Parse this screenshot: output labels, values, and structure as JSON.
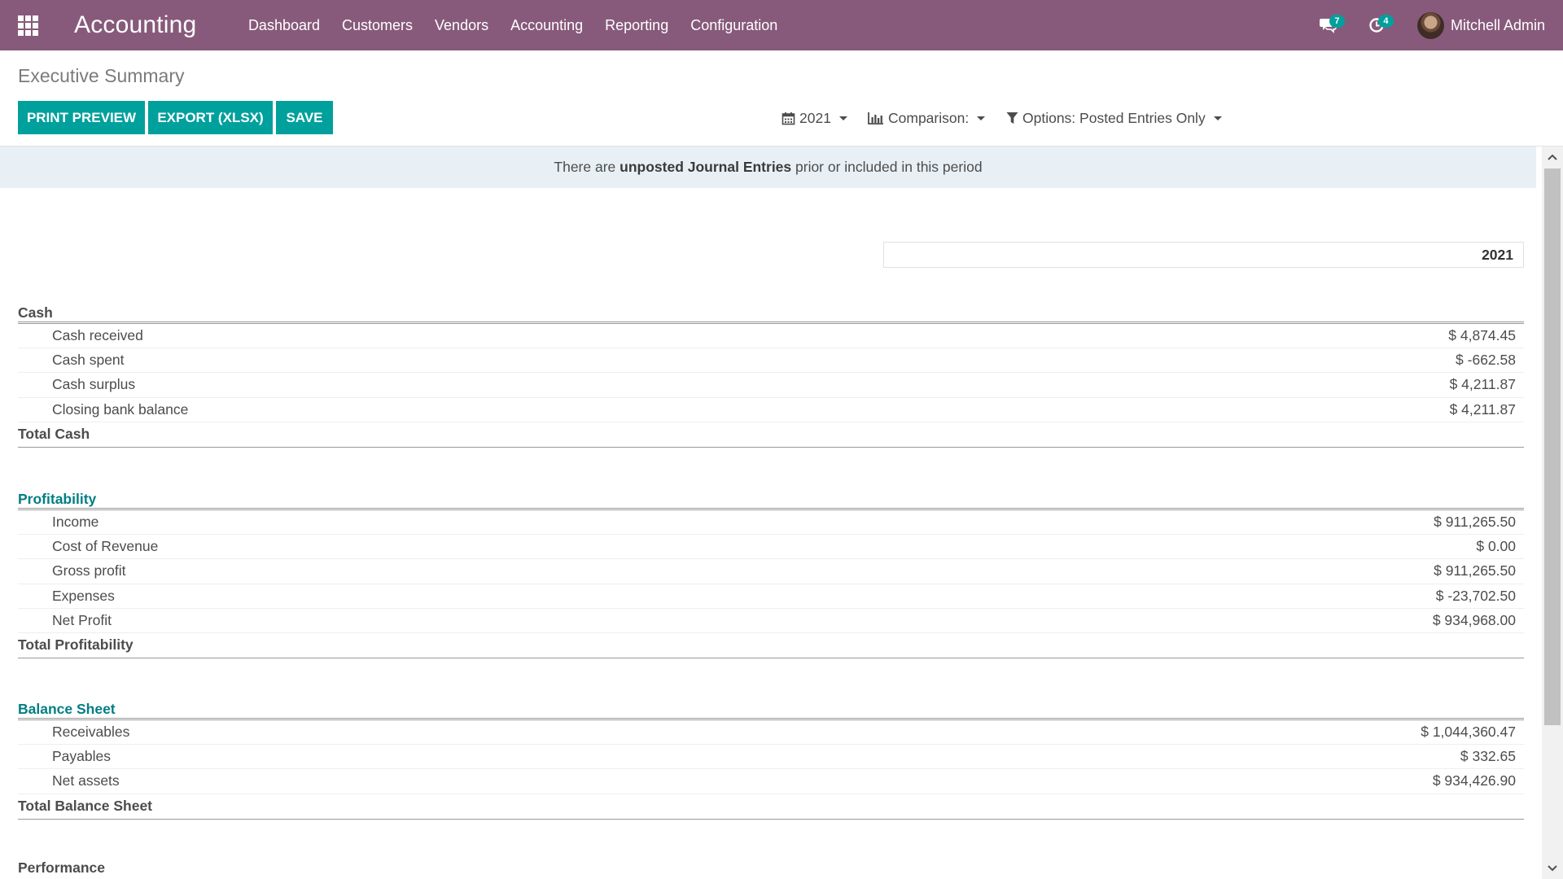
{
  "navbar": {
    "app_name": "Accounting",
    "menu": [
      "Dashboard",
      "Customers",
      "Vendors",
      "Accounting",
      "Reporting",
      "Configuration"
    ],
    "messages_count": "7",
    "activities_count": "4",
    "user_name": "Mitchell Admin",
    "icons": [
      "apps-grid-icon",
      "chat-icon",
      "clock-icon",
      "avatar"
    ]
  },
  "control_panel": {
    "title": "Executive Summary",
    "buttons": {
      "print_preview": "PRINT PREVIEW",
      "export": "EXPORT (XLSX)",
      "save": "SAVE"
    },
    "filters": {
      "date": "2021",
      "comparison": "Comparison:",
      "options": "Options: Posted Entries Only"
    }
  },
  "alert": {
    "prefix": "There are ",
    "bold": "unposted Journal Entries",
    "suffix": " prior or included in this period"
  },
  "report": {
    "column_header": "2021",
    "sections": [
      {
        "title": "Cash",
        "lines": [
          {
            "name": "Cash received",
            "value": "$ 4,874.45"
          },
          {
            "name": "Cash spent",
            "value": "$ -662.58"
          },
          {
            "name": "Cash surplus",
            "value": "$ 4,211.87"
          },
          {
            "name": "Closing bank balance",
            "value": "$ 4,211.87"
          }
        ],
        "total": "Total Cash"
      },
      {
        "title": "Profitability",
        "lines": [
          {
            "name": "Income",
            "value": "$ 911,265.50"
          },
          {
            "name": "Cost of Revenue",
            "value": "$ 0.00"
          },
          {
            "name": "Gross profit",
            "value": "$ 911,265.50"
          },
          {
            "name": "Expenses",
            "value": "$ -23,702.50"
          },
          {
            "name": "Net Profit",
            "value": "$ 934,968.00"
          }
        ],
        "total": "Total Profitability"
      },
      {
        "title": "Balance Sheet",
        "lines": [
          {
            "name": "Receivables",
            "value": "$ 1,044,360.47"
          },
          {
            "name": "Payables",
            "value": "$ 332.65"
          },
          {
            "name": "Net assets",
            "value": "$ 934,426.90"
          }
        ],
        "total": "Total Balance Sheet"
      },
      {
        "title": "Performance",
        "lines": [],
        "total": ""
      }
    ]
  },
  "colors": {
    "navbar": "#875a7b",
    "primary_button": "#00a09d",
    "section_link": "#017e84",
    "alert_bg": "#e9f0f5"
  }
}
